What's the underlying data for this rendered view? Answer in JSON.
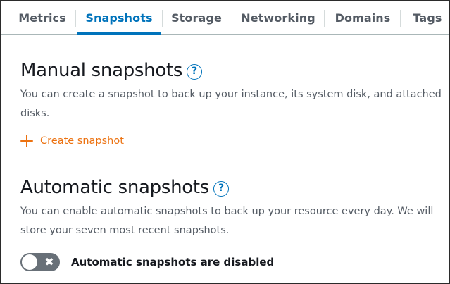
{
  "tabs": [
    {
      "label": "Metrics",
      "active": false
    },
    {
      "label": "Snapshots",
      "active": true
    },
    {
      "label": "Storage",
      "active": false
    },
    {
      "label": "Networking",
      "active": false
    },
    {
      "label": "Domains",
      "active": false
    },
    {
      "label": "Tags",
      "active": false
    }
  ],
  "manual": {
    "title": "Manual snapshots",
    "help_icon": "?",
    "description": "You can create a snapshot to back up your instance, its system disk, and attached disks.",
    "create_label": "Create snapshot",
    "create_icon": "plus-icon"
  },
  "automatic": {
    "title": "Automatic snapshots",
    "help_icon": "?",
    "description": "You can enable automatic snapshots to back up your resource every day. We will store your seven most recent snapshots.",
    "toggle_state": "off",
    "toggle_icon": "✖",
    "toggle_label": "Automatic snapshots are disabled"
  },
  "colors": {
    "accent": "#0073bb",
    "link": "#ec7211",
    "toggle_off": "#687078",
    "text": "#16191f",
    "muted": "#545b64"
  }
}
